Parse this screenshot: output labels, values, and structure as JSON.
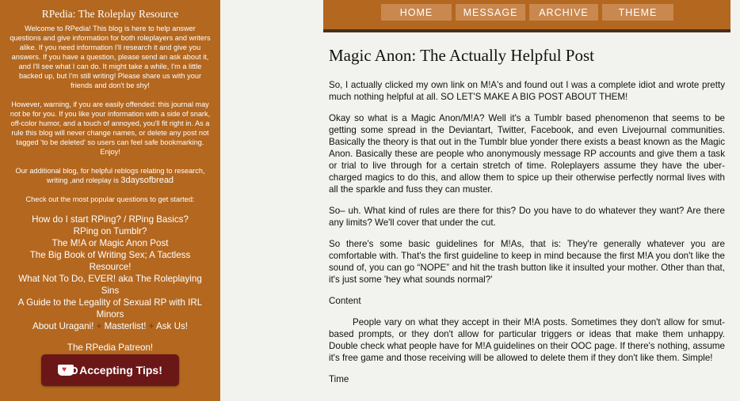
{
  "sidebar": {
    "title": "RPedia: The Roleplay Resource",
    "welcome": "Welcome to RPedia! This blog is here to help answer questions and give information for both roleplayers and writers alike. If you need information I'll research it and give you answers. If you have a question, please send an ask about it, and I'll see what I can do. It might take a while, I'm a little backed up, but I'm still writing! Please share us with your friends and don't be shy!",
    "warning": "However, warning, if you are easily offended: this journal may not be for you. If you like your information with a side of snark, off-color humor, and a touch of annoyed, you'll fit right in. As a rule this blog will never change names, or delete any post not tagged 'to be deleted' so users can feel safe bookmarking. Enjoy!",
    "additional_prefix": "Our additional blog, for helpful reblogs relating to research, writing ,and roleplay is",
    "additional_link": "3daysofbread",
    "popular_intro": "Check out the most popular questions to get started:",
    "links": [
      "How do I start RPing? / RPing Basics?",
      "RPing on Tumblr?",
      "The M!A or Magic Anon Post",
      "The Big Book of Writing Sex; A Tactless Resource!",
      "What Not To Do, EVER! aka The Roleplaying Sins",
      "A Guide to the Legality of Sexual RP with IRL Minors"
    ],
    "inline_links": [
      "About Uragani!",
      "Masterlist!",
      "Ask Us!"
    ],
    "inline_separator": "+",
    "patreon": "The RPedia Patreon!",
    "tips_button": "Accepting Tips!"
  },
  "nav": [
    "HOME",
    "MESSAGE",
    "ARCHIVE",
    "THEME"
  ],
  "post": {
    "title": "Magic Anon: The Actually Helpful Post",
    "paragraphs": [
      "So, I actually clicked my own link on M!A's and found out I was a complete idiot and wrote pretty much nothing helpful at all. SO LET'S MAKE A BIG POST ABOUT THEM!",
      "Okay so what is a Magic Anon/M!A? Well it's a Tumblr based phenomenon that seems to be getting some spread in the Deviantart, Twitter, Facebook, and even Livejournal communities. Basically the theory is that out in the Tumblr blue yonder there exists a beast known as the Magic Anon. Basically these are people who anonymously message RP accounts and give them a task or trial to live through for a certain stretch of time. Roleplayers assume they have the uber-charged magics to do this, and allow them to spice up their otherwise perfectly normal lives with all the sparkle and fuss they can muster.",
      "So– uh. What kind of rules are there for this? Do you have to do whatever they want? Are there any limits? We'll cover that under the cut.",
      "So there's some basic guidelines for M!As, that is: They're generally whatever you are comfortable with. That's the first guideline to keep in mind because the first M!A you don't like the sound of, you can go “NOPE” and hit the trash button like it insulted your mother. Other than that, it's just some 'hey what sounds normal?'",
      "Content",
      "People vary on what they accept in their M!A posts. Sometimes they don't allow for smut-based prompts, or they don't allow for particular triggers or ideas that make them unhappy. Double check what people have for M!A guidelines on their OOC page. If there's nothing, assume it's free game and those receiving will be allowed to delete them if they don't like them. Simple!",
      "Time"
    ]
  },
  "colors": {
    "sidebar_bg": "#b3671f",
    "nav_item_bg": "#c9884f",
    "nav_border": "#4a2f1a",
    "page_bg": "#f2f2ee",
    "tips_button_bg": "#6b1717"
  },
  "icons": {
    "tips": "kofi-cup-icon"
  }
}
